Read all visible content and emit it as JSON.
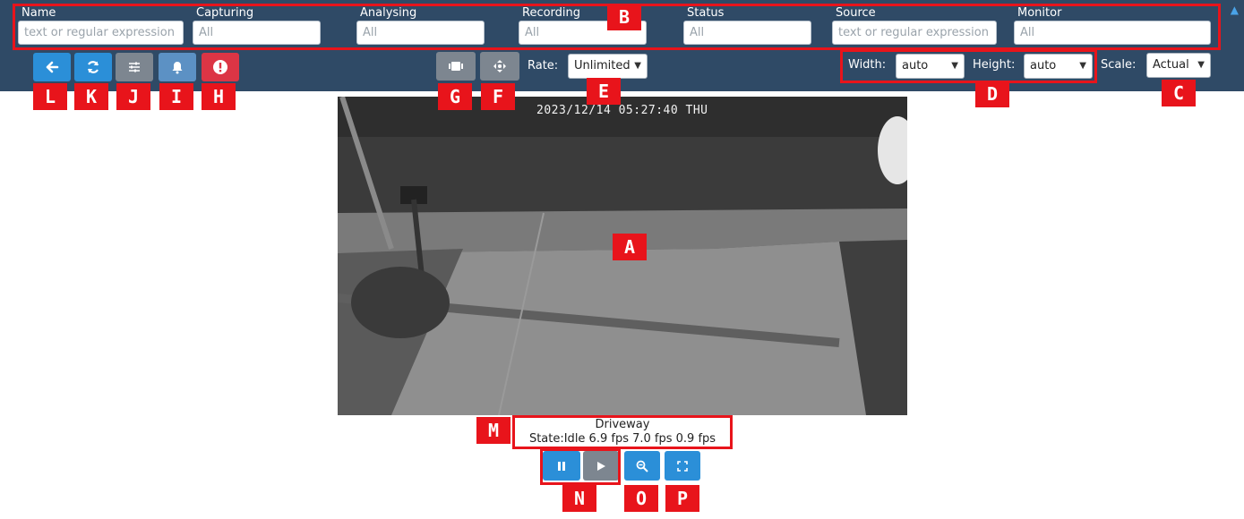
{
  "filters": [
    {
      "label": "Name",
      "placeholder": "text or regular expression"
    },
    {
      "label": "Capturing",
      "placeholder": "All"
    },
    {
      "label": "Analysing",
      "placeholder": "All"
    },
    {
      "label": "Recording",
      "placeholder": "All"
    },
    {
      "label": "Status",
      "placeholder": "All"
    },
    {
      "label": "Source",
      "placeholder": "text or regular expression"
    },
    {
      "label": "Monitor",
      "placeholder": "All"
    }
  ],
  "toolbar": {
    "rate_label": "Rate:",
    "rate_value": "Unlimited",
    "width_label": "Width:",
    "width_value": "auto",
    "height_label": "Height:",
    "height_value": "auto",
    "scale_label": "Scale:",
    "scale_value": "Actual"
  },
  "video": {
    "timestamp": "2023/12/14 05:27:40 THU"
  },
  "caption": {
    "name": "Driveway",
    "status": "State:Idle 6.9 fps 7.0 fps 0.9 fps"
  },
  "annotations": {
    "A": "A",
    "B": "B",
    "C": "C",
    "D": "D",
    "E": "E",
    "F": "F",
    "G": "G",
    "H": "H",
    "I": "I",
    "J": "J",
    "K": "K",
    "L": "L",
    "M": "M",
    "N": "N",
    "O": "O",
    "P": "P"
  },
  "icons": {
    "back": "arrow-left-icon",
    "refresh": "refresh-icon",
    "settings": "sliders-icon",
    "alarm": "bell-icon",
    "alert": "exclamation-circle-icon",
    "cycle": "film-icon",
    "ptz": "move-arrows-icon",
    "pause": "pause-icon",
    "play": "play-icon",
    "zoom": "zoom-out-icon",
    "fullscreen": "fullscreen-icon",
    "collapse": "chevron-up-icon"
  },
  "colors": {
    "topbar": "#2f4a66",
    "button_blue": "#2b8fd8",
    "button_grey": "#7d8690",
    "button_red": "#dc3545",
    "annotation_red": "#e8141b"
  }
}
